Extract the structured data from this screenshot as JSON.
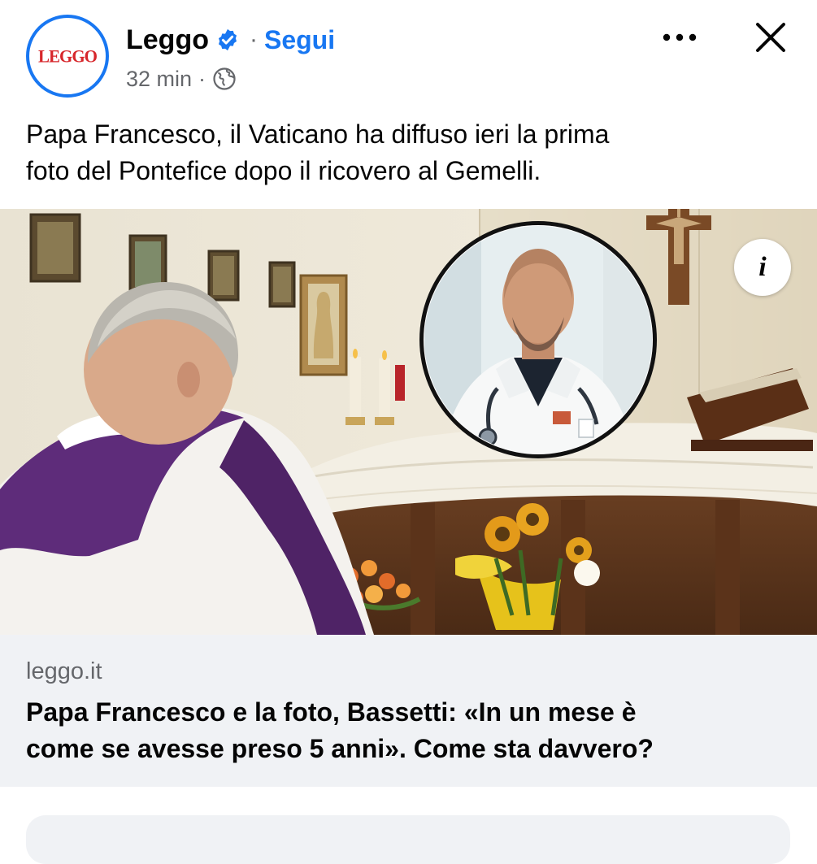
{
  "header": {
    "page_name": "Leggo",
    "avatar_logo": "LEGGO",
    "separator": "·",
    "follow_label": "Segui",
    "time": "32 min",
    "meta_separator": "·",
    "audience_icon": "globe-icon",
    "more_icon": "more-dots-icon",
    "close_icon": "close-icon"
  },
  "post": {
    "text_lines": [
      "Papa Francesco, il Vaticano ha diffuso ieri la prima",
      "foto del Pontefice dopo il ricovero al Gemelli."
    ]
  },
  "photo": {
    "info_label": "i"
  },
  "link": {
    "domain": "leggo.it",
    "title_lines": [
      "Papa Francesco e la foto, Bassetti: «In un mese è",
      "come se avesse preso 5 anni». Come sta davvero?"
    ]
  },
  "colors": {
    "accent": "#1877f2",
    "brand": "#d7262b",
    "secondary_text": "#65676b",
    "card_bg": "#f0f2f5"
  }
}
